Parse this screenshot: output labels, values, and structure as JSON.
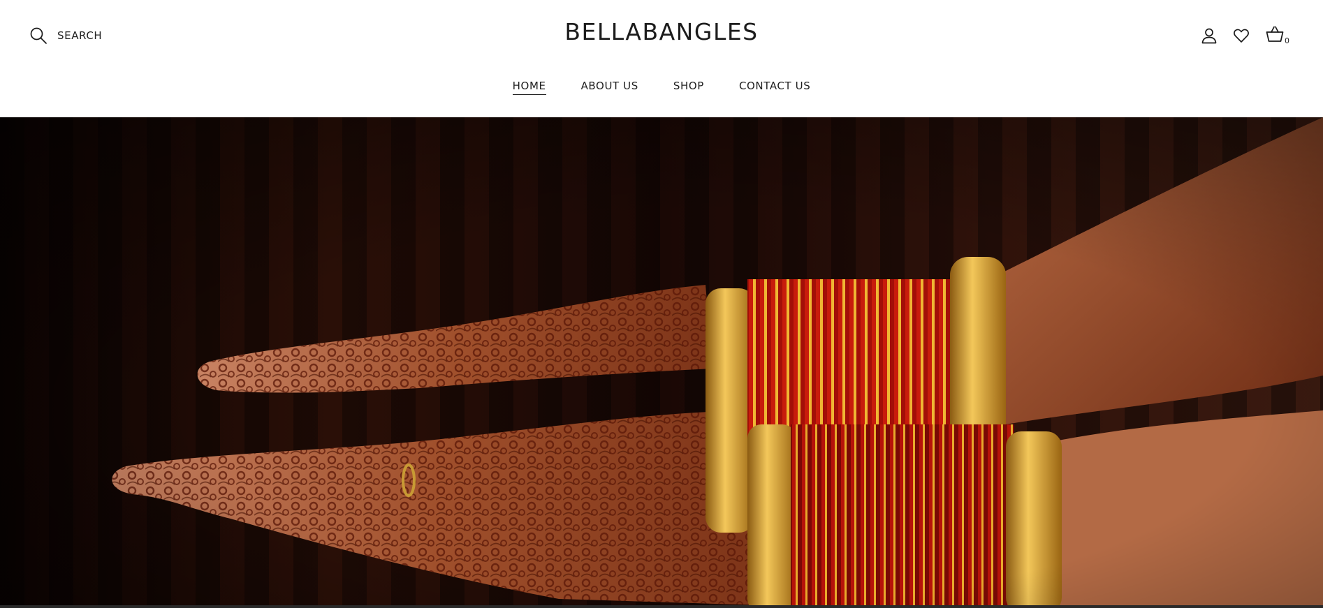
{
  "header": {
    "search_label": "SEARCH",
    "logo": "BELLABANGLES",
    "cart_count": "0",
    "icons": {
      "search": "search-icon",
      "account": "user-icon",
      "wishlist": "heart-icon",
      "cart": "basket-icon"
    }
  },
  "nav": {
    "items": [
      {
        "label": "HOME",
        "active": true
      },
      {
        "label": "ABOUT US",
        "active": false
      },
      {
        "label": "SHOP",
        "active": false
      },
      {
        "label": "CONTACT US",
        "active": false
      }
    ]
  },
  "hero": {
    "image": "hennaed-hands-with-red-and-gold-bangles",
    "colors": {
      "background": "#120604",
      "skin": "#a4532c",
      "bangle_red": "#c81c0c",
      "bangle_gold": "#e1a22a"
    }
  }
}
